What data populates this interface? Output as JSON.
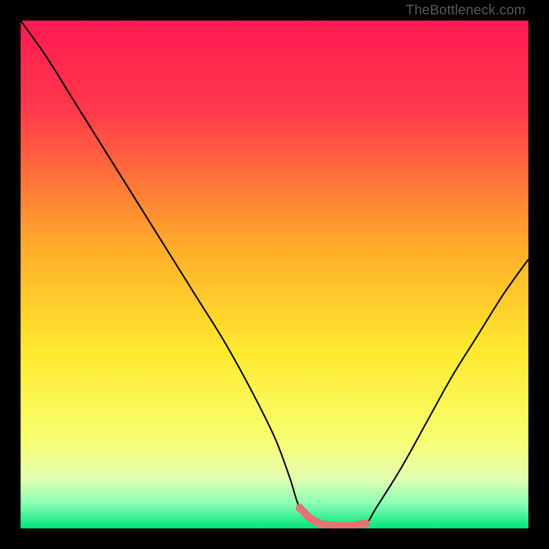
{
  "watermark": "TheBottleneck.com",
  "colors": {
    "frame": "#000000",
    "curve": "#000000",
    "optimal_marker": "#e57373",
    "gradient_stops": [
      {
        "pct": 0,
        "color": "#ff1a53"
      },
      {
        "pct": 18,
        "color": "#ff3a4a"
      },
      {
        "pct": 45,
        "color": "#ffae2a"
      },
      {
        "pct": 65,
        "color": "#ffe92e"
      },
      {
        "pct": 82,
        "color": "#f7ff6e"
      },
      {
        "pct": 90,
        "color": "#e6ffb0"
      },
      {
        "pct": 95,
        "color": "#8cffb8"
      },
      {
        "pct": 100,
        "color": "#00e47a"
      }
    ]
  },
  "chart_data": {
    "type": "line",
    "title": "",
    "xlabel": "",
    "ylabel": "",
    "xlim": [
      0,
      100
    ],
    "ylim": [
      0,
      100
    ],
    "optimal_range_x": [
      55,
      68
    ],
    "series": [
      {
        "name": "bottleneck-curve",
        "x": [
          0,
          5,
          10,
          15,
          20,
          25,
          30,
          35,
          40,
          45,
          50,
          53,
          55,
          58,
          62,
          65,
          68,
          70,
          75,
          80,
          85,
          90,
          95,
          100
        ],
        "y": [
          100,
          93,
          85,
          77,
          69,
          61,
          53,
          45,
          37,
          28,
          18,
          10,
          4,
          1,
          0.5,
          0.5,
          1,
          4,
          12,
          21,
          30,
          38,
          46,
          53
        ]
      }
    ],
    "optimal_markers_x": [
      55,
      57,
      59,
      61,
      63,
      65,
      67,
      68
    ]
  }
}
